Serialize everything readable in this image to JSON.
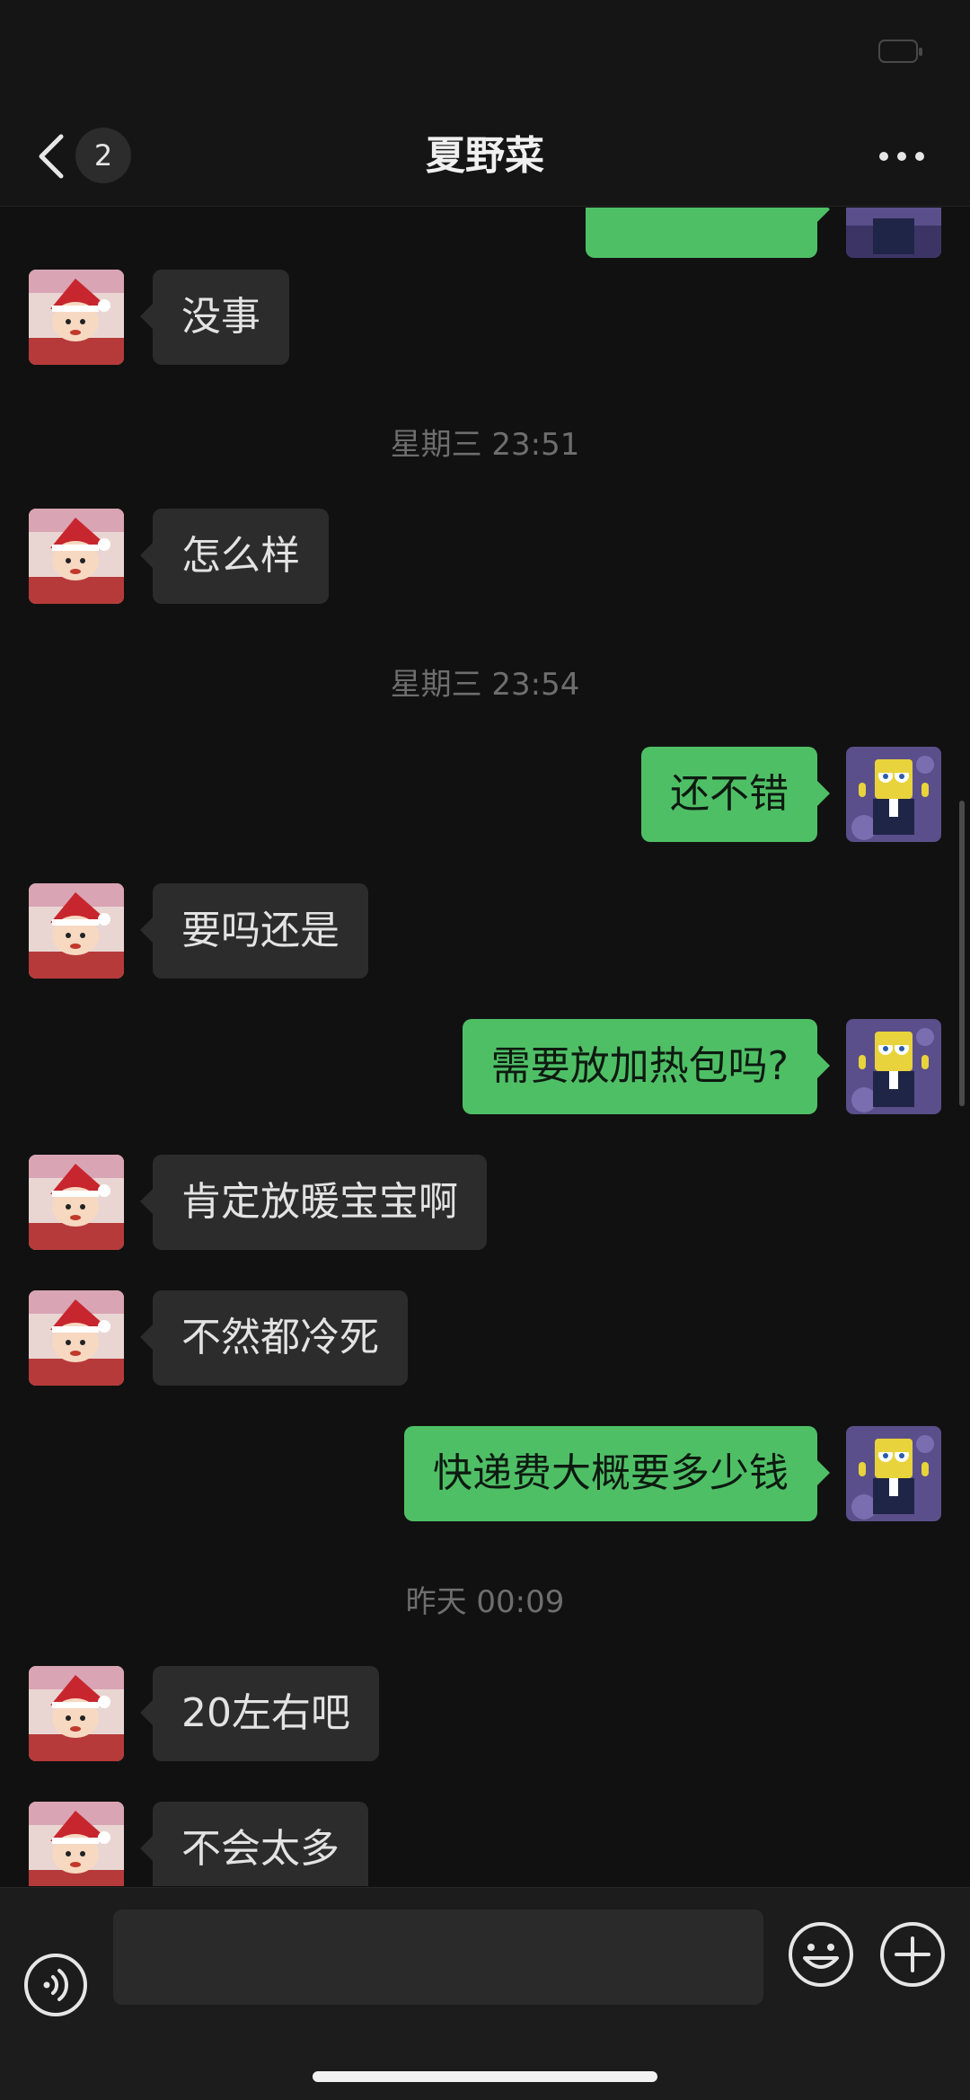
{
  "header": {
    "title": "夏野菜",
    "unread_count": "2"
  },
  "messages": [
    {
      "side": "in",
      "text": "没事"
    },
    {
      "timestamp": "星期三 23:51"
    },
    {
      "side": "in",
      "text": "怎么样"
    },
    {
      "timestamp": "星期三 23:54"
    },
    {
      "side": "out",
      "text": "还不错"
    },
    {
      "side": "in",
      "text": "要吗还是"
    },
    {
      "side": "out",
      "text": "需要放加热包吗?"
    },
    {
      "side": "in",
      "text": "肯定放暖宝宝啊"
    },
    {
      "side": "in",
      "text": "不然都冷死"
    },
    {
      "side": "out",
      "text": "快递费大概要多少钱"
    },
    {
      "timestamp": "昨天 00:09"
    },
    {
      "side": "in",
      "text": "20左右吧"
    },
    {
      "side": "in",
      "text": "不会太多"
    }
  ],
  "input": {
    "placeholder": ""
  },
  "icons": {
    "back": "chevron-left-icon",
    "more": "more-dots-icon",
    "voice": "voice-icon",
    "emoji": "emoji-icon",
    "plus": "plus-icon",
    "contact_avatar": "crayon-shin-chan-avatar",
    "my_avatar": "spongebob-avatar"
  },
  "colors": {
    "background": "#111111",
    "incoming_bubble": "#2c2c2c",
    "outgoing_bubble": "#4fbf66",
    "timestamp_text": "#6e6e6e"
  }
}
